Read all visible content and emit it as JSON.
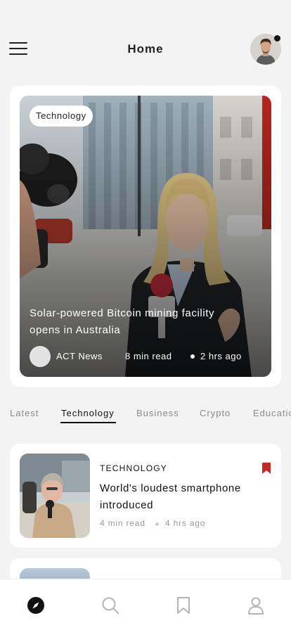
{
  "header": {
    "title": "Home",
    "menu_icon": "hamburger-icon",
    "profile_icon": "avatar",
    "notification_indicator": "dot"
  },
  "featured": {
    "tag": "Technology",
    "title": "Solar-powered Bitcoin mining facility opens in Australia",
    "source": "ACT News",
    "read_time": "8 min read",
    "ago": "2 hrs ago"
  },
  "tabs": [
    {
      "label": "Latest",
      "active": false
    },
    {
      "label": "Technology",
      "active": true
    },
    {
      "label": "Business",
      "active": false
    },
    {
      "label": "Crypto",
      "active": false
    },
    {
      "label": "Education",
      "active": false
    }
  ],
  "articles": [
    {
      "category": "TECHNOLOGY",
      "title": "World's loudest smartphone introduced",
      "read_time": "4 min read",
      "ago": "4 hrs ago",
      "bookmarked": true
    }
  ],
  "bottom_nav": [
    {
      "name": "explore-icon",
      "active": true
    },
    {
      "name": "search-icon",
      "active": false
    },
    {
      "name": "bookmark-icon",
      "active": false
    },
    {
      "name": "profile-icon",
      "active": false
    }
  ],
  "colors": {
    "background": "#f3f3f3",
    "card": "#ffffff",
    "text": "#111111",
    "muted": "#8a8a8a",
    "bookmark_accent": "#c62828"
  }
}
